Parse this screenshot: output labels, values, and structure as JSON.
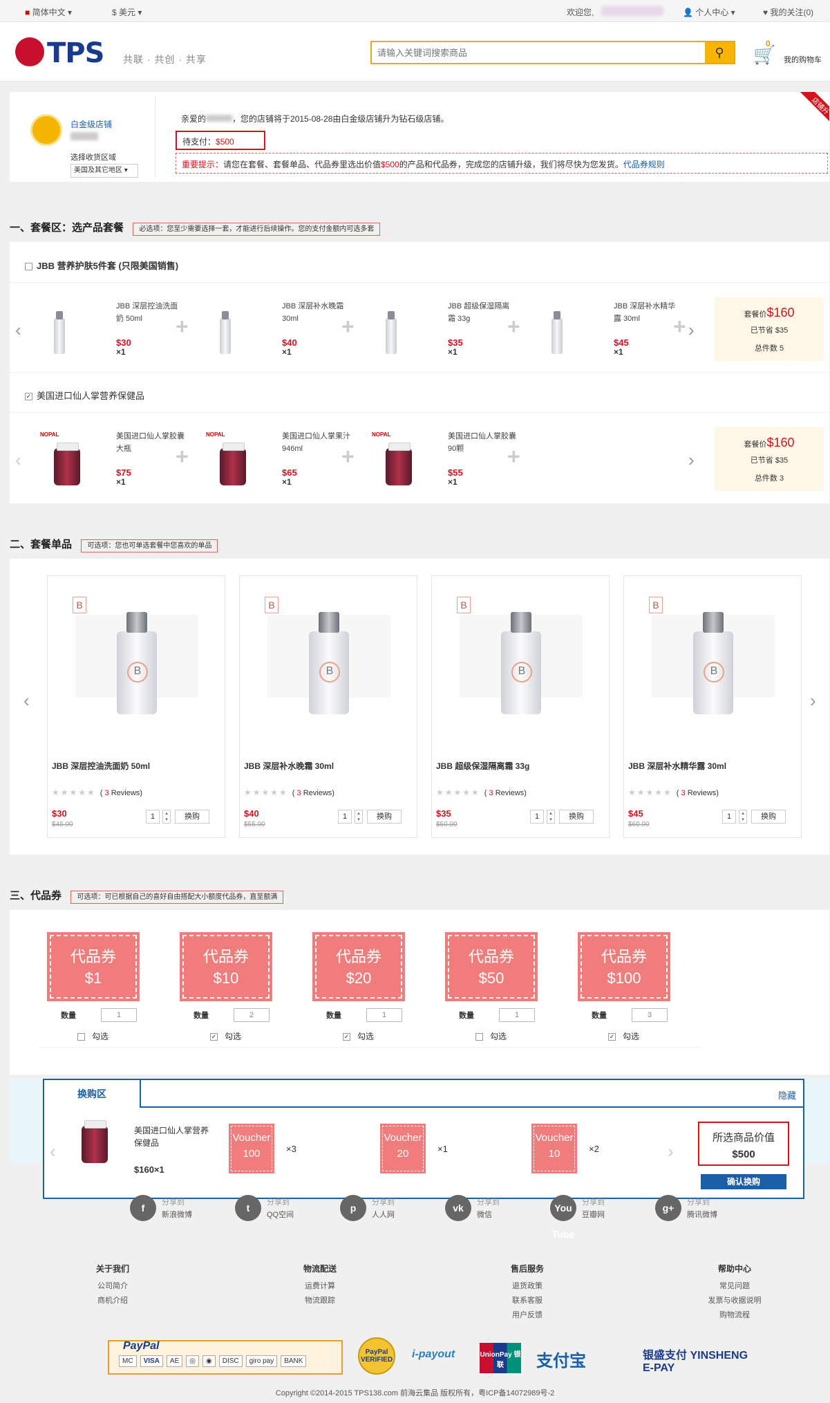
{
  "topbar": {
    "language": "简体中文",
    "currency": "$ 美元",
    "welcome": "欢迎您,",
    "account": "个人中心",
    "follow": "我的关注(0)"
  },
  "header": {
    "logo": "TPS",
    "slogan": "共联 · 共创 · 共享",
    "search_placeholder": "请输入关键词搜索商品",
    "cart_count": "0",
    "cart_label": "我的购物车"
  },
  "store": {
    "level": "白金级店铺",
    "region_label": "选择收货区域",
    "region_value": "美国及其它地区",
    "greeting_prefix": "亲爱的",
    "greeting_suffix": "，您的店铺将于2015-08-28由白金级店铺升为钻石级店铺。",
    "pay_label": "待支付：",
    "pay_amount": "$500",
    "notice_label": "重要提示：",
    "notice_text_1": "请您在套餐、套餐单品、代品券里选出价值",
    "notice_amount": "$500",
    "notice_text_2": "的产品和代品券，完成您的店铺升级，我们将尽快为您发货。",
    "notice_link": "代品券规则",
    "corner": "店铺升"
  },
  "section1": {
    "title": "一、套餐区：选产品套餐",
    "tag": "必选项：您至少需要选择一套，才能进行后续操作。您的支付金额内可选多套"
  },
  "package1": {
    "title": "JBB 营养护肤5件套 (只限美国销售)",
    "items": [
      {
        "name": "JBB 深层控油洗面奶 50ml",
        "price": "$30",
        "qty": "×1"
      },
      {
        "name": "JBB 深层补水晚霜 30ml",
        "price": "$40",
        "qty": "×1"
      },
      {
        "name": "JBB 超级保湿隔离霜 33g",
        "price": "$35",
        "qty": "×1"
      },
      {
        "name": "JBB 深层补水精华露 30ml",
        "price": "$45",
        "qty": "×1"
      }
    ],
    "price_label": "套餐价",
    "price": "$160",
    "save": "已节省 $35",
    "count": "总件数 5"
  },
  "package2": {
    "title": "美国进口仙人掌营养保健品",
    "items": [
      {
        "name": "美国进口仙人掌胶囊大瓶",
        "price": "$75",
        "qty": "×1",
        "brand": "NOPAL"
      },
      {
        "name": "美国进口仙人掌果汁 946ml",
        "price": "$65",
        "qty": "×1",
        "brand": "NOPAL"
      },
      {
        "name": "美国进口仙人掌胶囊90颗",
        "price": "$55",
        "qty": "×1",
        "brand": "NOPAL"
      }
    ],
    "price_label": "套餐价",
    "price": "$160",
    "save": "已节省 $35",
    "count": "总件数 3"
  },
  "section2": {
    "title": "二、套餐单品",
    "tag": "可选项：您也可单选套餐中您喜欢的单品"
  },
  "singles": [
    {
      "name": "JBB 深层控油洗面奶 50ml",
      "reviews_pre": "( ",
      "reviews_num": "3",
      "reviews_post": " Reviews)",
      "price": "$30",
      "old": "$45.00",
      "qty": "1",
      "swap": "换购"
    },
    {
      "name": "JBB 深层补水晚霜 30ml",
      "reviews_pre": "( ",
      "reviews_num": "3",
      "reviews_post": " Reviews)",
      "price": "$40",
      "old": "$55.00",
      "qty": "1",
      "swap": "换购"
    },
    {
      "name": "JBB 超级保湿隔离霜 33g",
      "reviews_pre": "( ",
      "reviews_num": "3",
      "reviews_post": " Reviews)",
      "price": "$35",
      "old": "$50.00",
      "qty": "1",
      "swap": "换购"
    },
    {
      "name": "JBB 深层补水精华露 30ml",
      "reviews_pre": "( ",
      "reviews_num": "3",
      "reviews_post": " Reviews)",
      "price": "$45",
      "old": "$60.00",
      "qty": "1",
      "swap": "换购"
    }
  ],
  "section3": {
    "title": "三、代品券",
    "tag": "可选项：可已根据自己的喜好自由搭配大小额度代品券，直至额满"
  },
  "vouchers": [
    {
      "title": "代品券",
      "value": "$1",
      "qty_label": "数量",
      "qty": "1",
      "check": "勾选",
      "checked": false
    },
    {
      "title": "代品券",
      "value": "$10",
      "qty_label": "数量",
      "qty": "2",
      "check": "勾选",
      "checked": true
    },
    {
      "title": "代品券",
      "value": "$20",
      "qty_label": "数量",
      "qty": "1",
      "check": "勾选",
      "checked": true
    },
    {
      "title": "代品券",
      "value": "$50",
      "qty_label": "数量",
      "qty": "1",
      "check": "勾选",
      "checked": false
    },
    {
      "title": "代品券",
      "value": "$100",
      "qty_label": "数量",
      "qty": "3",
      "check": "勾选",
      "checked": true
    }
  ],
  "swap": {
    "tab": "换购区",
    "hide": "隐藏",
    "product_name": "美国进口仙人掌营养保健品",
    "product_price": "$160×1",
    "items": [
      {
        "label": "Voucher",
        "value": "100",
        "mult": "×3"
      },
      {
        "label": "Voucher",
        "value": "20",
        "mult": "×1"
      },
      {
        "label": "Voucher",
        "value": "10",
        "mult": "×2"
      }
    ],
    "total_label": "所选商品价值",
    "total": "$500",
    "confirm": "确认换购"
  },
  "share": [
    {
      "icon": "f",
      "top": "分享到",
      "name": "新浪微博"
    },
    {
      "icon": "t",
      "top": "分享到",
      "name": "QQ空间"
    },
    {
      "icon": "p",
      "top": "分享到",
      "name": "人人网"
    },
    {
      "icon": "vk",
      "top": "分享到",
      "name": "微信"
    },
    {
      "icon": "You Tube",
      "top": "分享到",
      "name": "豆瓣网"
    },
    {
      "icon": "g+",
      "top": "分享到",
      "name": "腾讯微博"
    }
  ],
  "footer_cols": [
    {
      "title": "关于我们",
      "links": [
        "公司简介",
        "商机介绍"
      ]
    },
    {
      "title": "物流配送",
      "links": [
        "运费计算",
        "物流跟踪"
      ]
    },
    {
      "title": "售后服务",
      "links": [
        "退货政策",
        "联系客服",
        "用户反馈"
      ]
    },
    {
      "title": "帮助中心",
      "links": [
        "常见问题",
        "发票与收据说明",
        "购物流程"
      ]
    }
  ],
  "payments": [
    "PayPal",
    "VISA",
    "giro pay",
    "BANK",
    "PayPal VERIFIED",
    "i-payout",
    "UnionPay 银联",
    "支付宝",
    "银盛支付 YINSHENG E-PAY"
  ],
  "copyright": "Copyright ©2014-2015 TPS138.com 前海云集品 版权所有，粤ICP备14072989号-2",
  "colors": {
    "accent": "#d4121c",
    "voucher": "#f07c7c",
    "link": "#1a5ea8",
    "search_border": "#f1a600"
  }
}
